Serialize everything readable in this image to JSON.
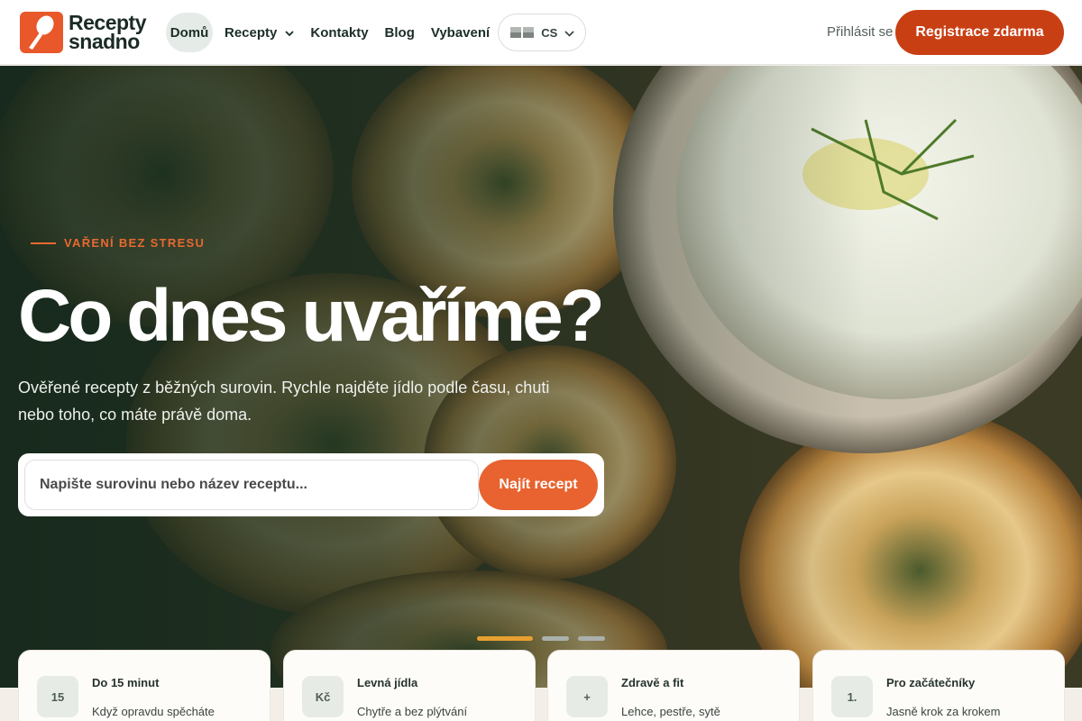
{
  "brand": {
    "line1": "Recepty",
    "line2": "snadno"
  },
  "nav": {
    "items": [
      {
        "label": "Domů",
        "active": true
      },
      {
        "label": "Recepty",
        "dropdown": true
      },
      {
        "label": "Kontakty"
      },
      {
        "label": "Blog"
      },
      {
        "label": "Vybavení"
      }
    ],
    "language": "CS"
  },
  "header": {
    "login_label": "Přihlásit se",
    "register_label": "Registrace zdarma"
  },
  "hero": {
    "eyebrow": "VAŘENÍ BEZ STRESU",
    "title": "Co dnes uvaříme?",
    "subtitle": "Ověřené recepty z běžných surovin. Rychle najděte jídlo podle času, chuti nebo toho, co máte právě doma.",
    "search_placeholder": "Napište surovinu nebo název receptu...",
    "search_value": "",
    "search_button": "Najít recept",
    "slides": {
      "count": 3,
      "active": 1
    }
  },
  "categories": [
    {
      "badge": "15",
      "title": "Do 15 minut",
      "desc": "Když opravdu spěcháte"
    },
    {
      "badge": "Kč",
      "title": "Levná jídla",
      "desc": "Chytře a bez plýtvání"
    },
    {
      "badge": "+",
      "title": "Zdravě a fit",
      "desc": "Lehce, pestře, sytě"
    },
    {
      "badge": "1.",
      "title": "Pro začátečníky",
      "desc": "Jasně krok za krokem"
    }
  ],
  "colors": {
    "accent": "#e8632f",
    "register": "#c93f14",
    "dark_green": "#1c2e25",
    "active_slide": "#e8a030"
  },
  "icons": [
    "spoon-logo-icon",
    "chevron-down-icon",
    "flag-icon"
  ]
}
